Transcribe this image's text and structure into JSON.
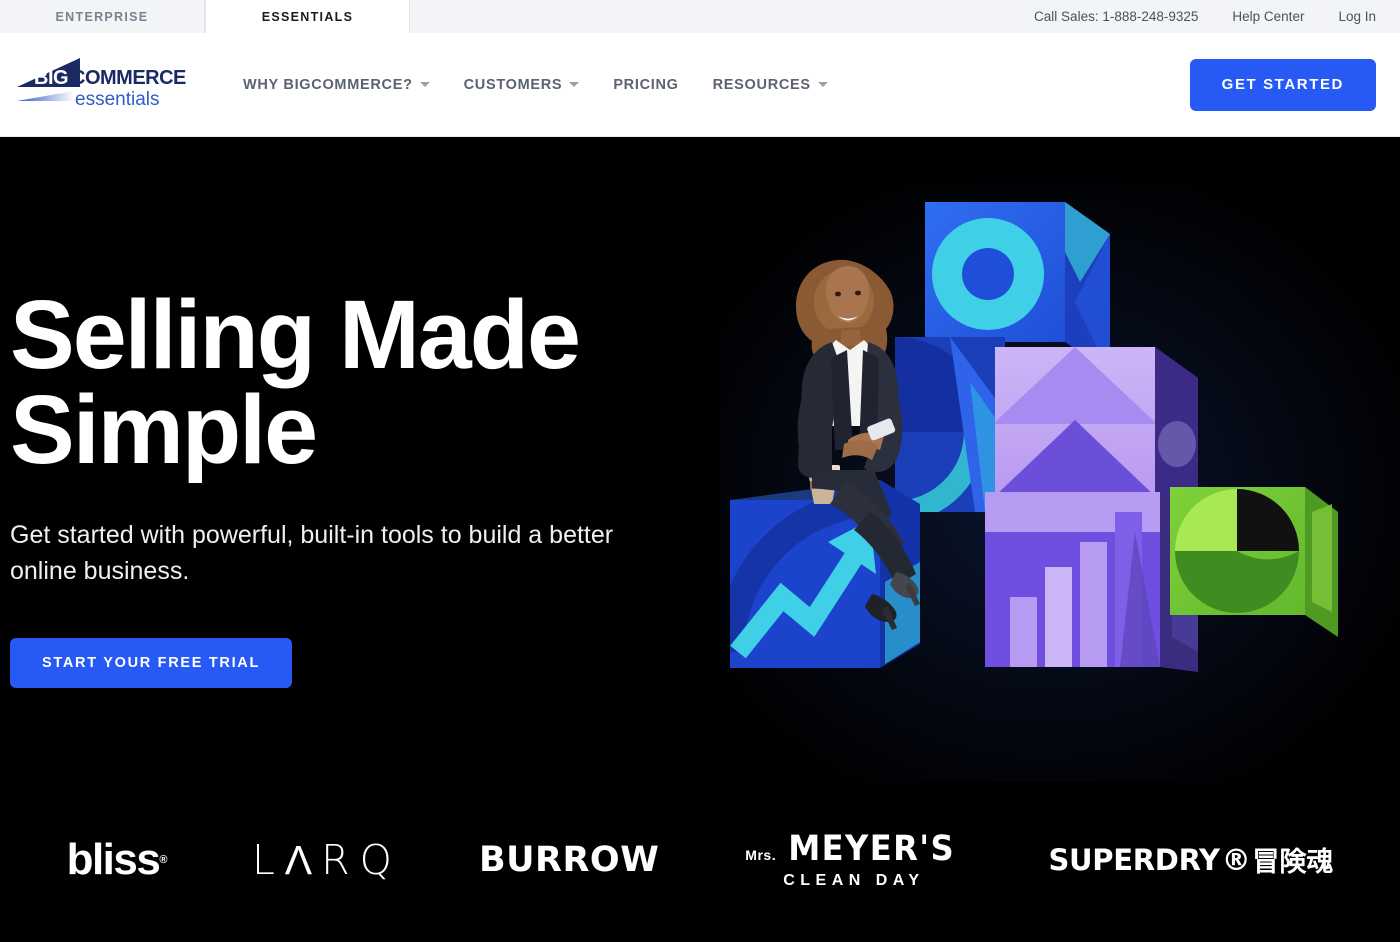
{
  "utility_bar": {
    "tabs": [
      {
        "label": "ENTERPRISE",
        "active": false
      },
      {
        "label": "ESSENTIALS",
        "active": true
      }
    ],
    "links": [
      {
        "label": "Call Sales: 1-888-248-9325",
        "name": "call-sales-link"
      },
      {
        "label": "Help Center",
        "name": "help-center-link"
      },
      {
        "label": "Log In",
        "name": "log-in-link"
      }
    ]
  },
  "header": {
    "logo": {
      "big": "BIG",
      "commerce": "COMMERCE",
      "essentials": "essentials"
    },
    "nav": [
      {
        "label": "WHY BIGCOMMERCE?",
        "has_dropdown": true
      },
      {
        "label": "CUSTOMERS",
        "has_dropdown": true
      },
      {
        "label": "PRICING",
        "has_dropdown": false
      },
      {
        "label": "RESOURCES",
        "has_dropdown": true
      }
    ],
    "cta_label": "GET STARTED"
  },
  "hero": {
    "title_line1": "Selling Made",
    "title_line2": "Simple",
    "subtitle": "Get started with powerful, built-in tools to build a better online business.",
    "cta_label": "START YOUR FREE TRIAL"
  },
  "logo_strip": {
    "brands": [
      {
        "name": "bliss",
        "text": "bliss",
        "mark": "®"
      },
      {
        "name": "larq",
        "text": "LARQ"
      },
      {
        "name": "burrow",
        "text": "BURROW"
      },
      {
        "name": "mrs-meyers-clean-day",
        "prefix": "Mrs.",
        "text": "MEYER'S",
        "sub": "CLEAN DAY"
      },
      {
        "name": "superdry",
        "text": "SUPERDRY",
        "mark": "®",
        "jp": "冒険魂"
      }
    ]
  },
  "colors": {
    "accent_blue": "#2759f5",
    "utility_bg": "#f2f4f7",
    "hero_bg": "#000000",
    "nav_text": "#5b6270",
    "logo_navy": "#1b2a63",
    "logo_blue": "#2e5cc8"
  }
}
